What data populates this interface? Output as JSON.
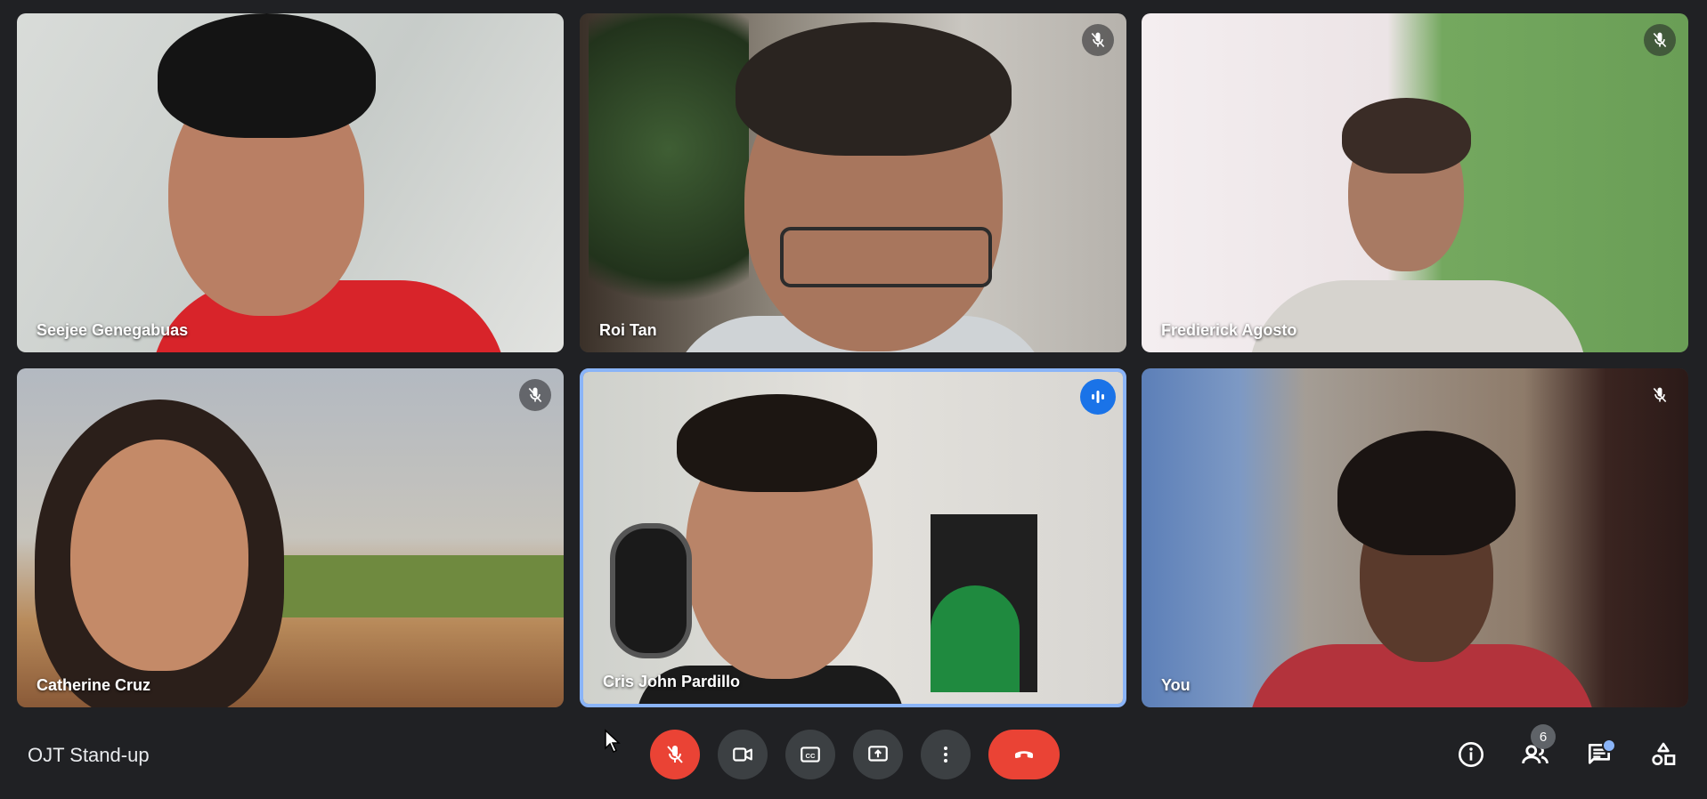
{
  "meeting": {
    "title": "OJT Stand-up"
  },
  "participants": [
    {
      "name": "Seejee Genegabuas",
      "muted": false,
      "speaking": false
    },
    {
      "name": "Roi Tan",
      "muted": true,
      "speaking": false
    },
    {
      "name": "Fredierick Agosto",
      "muted": true,
      "speaking": false
    },
    {
      "name": "Catherine Cruz",
      "muted": true,
      "speaking": false
    },
    {
      "name": "Cris John Pardillo",
      "muted": false,
      "speaking": true
    },
    {
      "name": "You",
      "muted": true,
      "speaking": false
    }
  ],
  "controls": {
    "mic": "mic-off-icon",
    "camera": "camera-icon",
    "captions": "closed-captions-icon",
    "present": "present-screen-icon",
    "more": "more-vert-icon",
    "leave": "hang-up-icon"
  },
  "side_controls": {
    "participant_count": "6"
  },
  "colors": {
    "background": "#202124",
    "accent": "#8ab4f8",
    "danger": "#ea4335",
    "speaking": "#1a73e8"
  }
}
